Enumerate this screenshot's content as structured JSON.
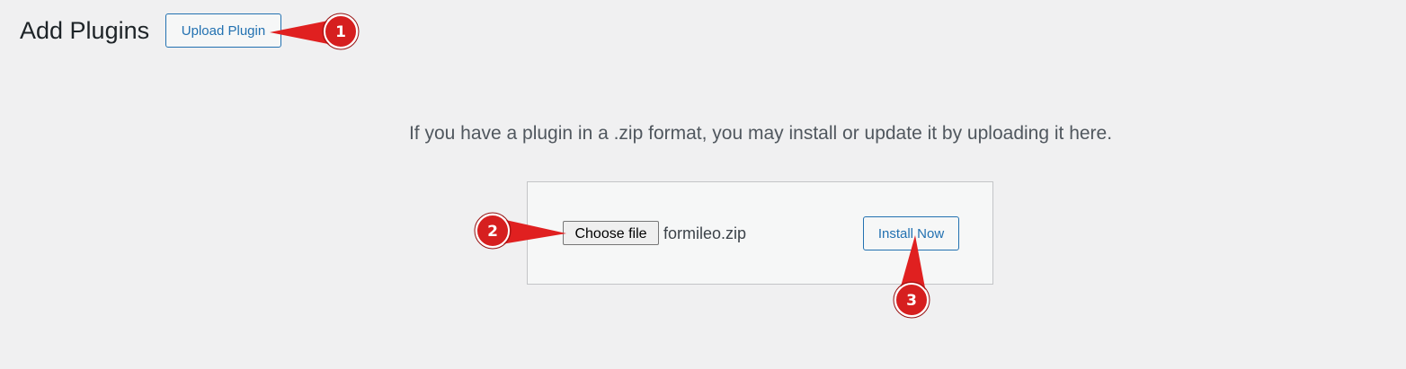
{
  "header": {
    "title": "Add Plugins",
    "upload_button": "Upload Plugin"
  },
  "upload": {
    "help_text": "If you have a plugin in a .zip format, you may install or update it by uploading it here.",
    "choose_file_label": "Choose file",
    "file_name": "formileo.zip",
    "install_button": "Install Now"
  },
  "annotations": {
    "color": "#e02020",
    "badges": [
      "1",
      "2",
      "3"
    ]
  }
}
